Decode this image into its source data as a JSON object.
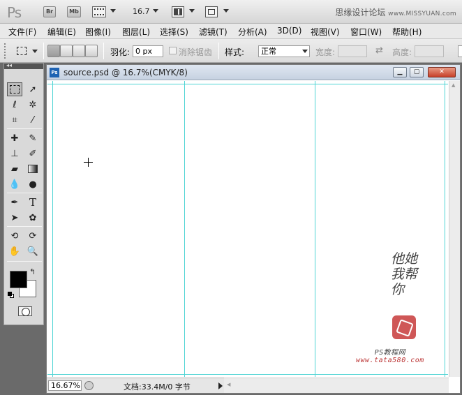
{
  "appbar": {
    "logo": "Ps",
    "bridge_label": "Br",
    "minibridge_label": "Mb",
    "zoom_value": "16.7",
    "brand_cn": "思缘设计论坛",
    "brand_en": "www.MISSYUAN.com"
  },
  "menu": {
    "items": [
      "文件(F)",
      "编辑(E)",
      "图像(I)",
      "图层(L)",
      "选择(S)",
      "滤镜(T)",
      "分析(A)",
      "3D(D)",
      "视图(V)",
      "窗口(W)",
      "帮助(H)"
    ]
  },
  "options": {
    "feather_label": "羽化:",
    "feather_value": "0 px",
    "antialias_label": "消除锯齿",
    "style_label": "样式:",
    "style_value": "正常",
    "width_label": "宽度:",
    "height_label": "高度:"
  },
  "document": {
    "title": "source.psd @ 16.7%(CMYK/8)",
    "ps_icon": "Ps",
    "zoom_field": "16.67%",
    "doc_info": "文档:33.4M/0 字节"
  },
  "watermark": {
    "chars": "他她我帮你",
    "site_line1": "PS教程网",
    "site_line2": "www.tata580.com"
  },
  "colors": {
    "foreground": "#000000",
    "background": "#ffffff",
    "guide": "#4fd4d4"
  }
}
